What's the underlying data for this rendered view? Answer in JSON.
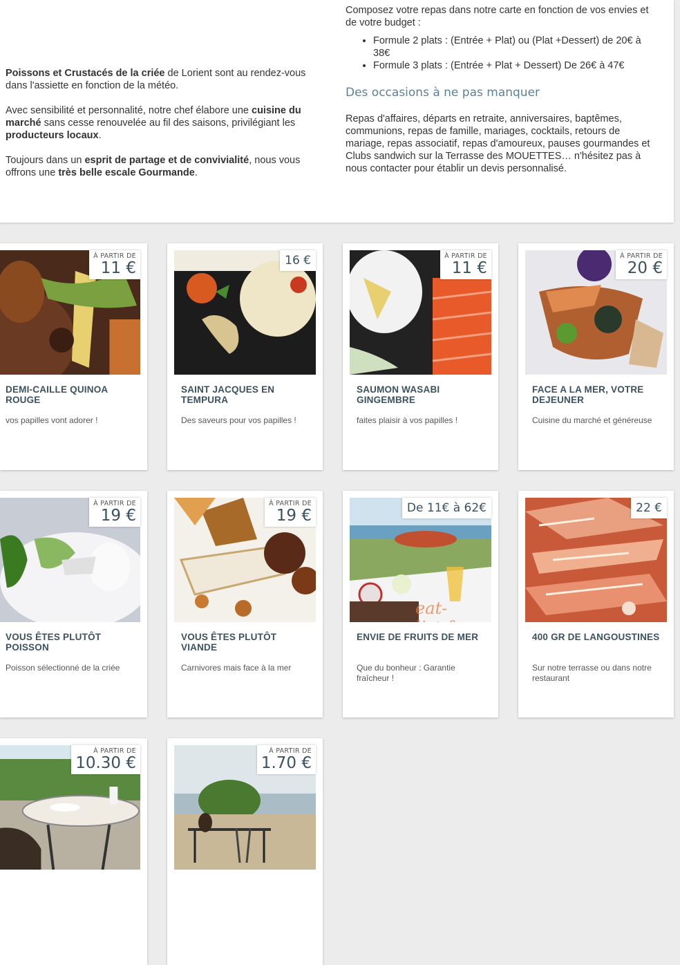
{
  "intro": {
    "left": {
      "p1_b": "Poissons et Crustacés de la criée",
      "p1_t": " de Lorient sont au rendez-vous dans l'assiette en fonction de la météo.",
      "p2_a": "Avec sensibilité et personnalité, notre chef élabore une ",
      "p2_b1": "cuisine du marché",
      "p2_c": " sans cesse renouvelée au fil des saisons, privilégiant les ",
      "p2_b2": "producteurs locaux",
      "p2_d": ".",
      "p3_a": "Toujours dans un ",
      "p3_b1": "esprit de partage et de convivialité",
      "p3_c": ", nous vous offrons une ",
      "p3_b2": "très belle escale Gourmande",
      "p3_d": "."
    },
    "right": {
      "lead": "Composez votre repas dans notre carte en fonction de vos envies et de votre budget :",
      "formules": [
        "Formule 2 plats : (Entrée + Plat) ou (Plat +Dessert) de 20€ à 38€",
        "Formule 3 plats : (Entrée + Plat + Dessert) De 26€ à 47€"
      ],
      "occasions_title": "Des occasions à ne pas manquer",
      "occasions_text": "Repas d'affaires, départs en retraite, anniversaires, baptêmes, communions, repas de famille, mariages, cocktails, retours de mariage, repas associatif, repas d'amoureux, pauses gourmandes et Clubs sandwich sur la Terrasse des MOUETTES… n'hésitez pas à nous contacter pour établir un devis personnalisé."
    }
  },
  "cards": [
    {
      "title": "DEMI-CAILLE QUINOA ROUGE",
      "desc": "vos papilles vont adorer !",
      "prefix": "À PARTIR DE",
      "price": "11 €"
    },
    {
      "title": "SAINT JACQUES EN TEMPURA",
      "desc": "Des saveurs pour vos papilles !",
      "prefix": "",
      "price": "16 €"
    },
    {
      "title": "SAUMON WASABI GINGEMBRE",
      "desc": "faites plaisir à vos papilles !",
      "prefix": "À PARTIR DE",
      "price": "11 €"
    },
    {
      "title": "FACE A LA MER, VOTRE DEJEUNER",
      "desc": "Cuisine du marché et généreuse",
      "prefix": "À PARTIR DE",
      "price": "20 €"
    },
    {
      "title": "VOUS ÊTES PLUTÔT POISSON",
      "desc": "Poisson sélectionné de la criée",
      "prefix": "À PARTIR DE",
      "price": "19 €"
    },
    {
      "title": "VOUS ÊTES PLUTÔT VIANDE",
      "desc": "Carnivores mais face à la mer",
      "prefix": "À PARTIR DE",
      "price": "19 €"
    },
    {
      "title": "ENVIE DE FRUITS DE MER",
      "desc": "Que du bonheur : Garantie fraîcheur !",
      "prefix": "",
      "price": "De 11€ à 62€",
      "watermark": "eat-list.fr"
    },
    {
      "title": "400 GR DE LANGOUSTINES",
      "desc": "Sur notre terrasse ou dans notre restaurant",
      "prefix": "",
      "price": "22 €"
    },
    {
      "title": "",
      "desc": "",
      "prefix": "À PARTIR DE",
      "price": "10.30 €"
    },
    {
      "title": "",
      "desc": "",
      "prefix": "À PARTIR DE",
      "price": "1.70 €"
    }
  ]
}
